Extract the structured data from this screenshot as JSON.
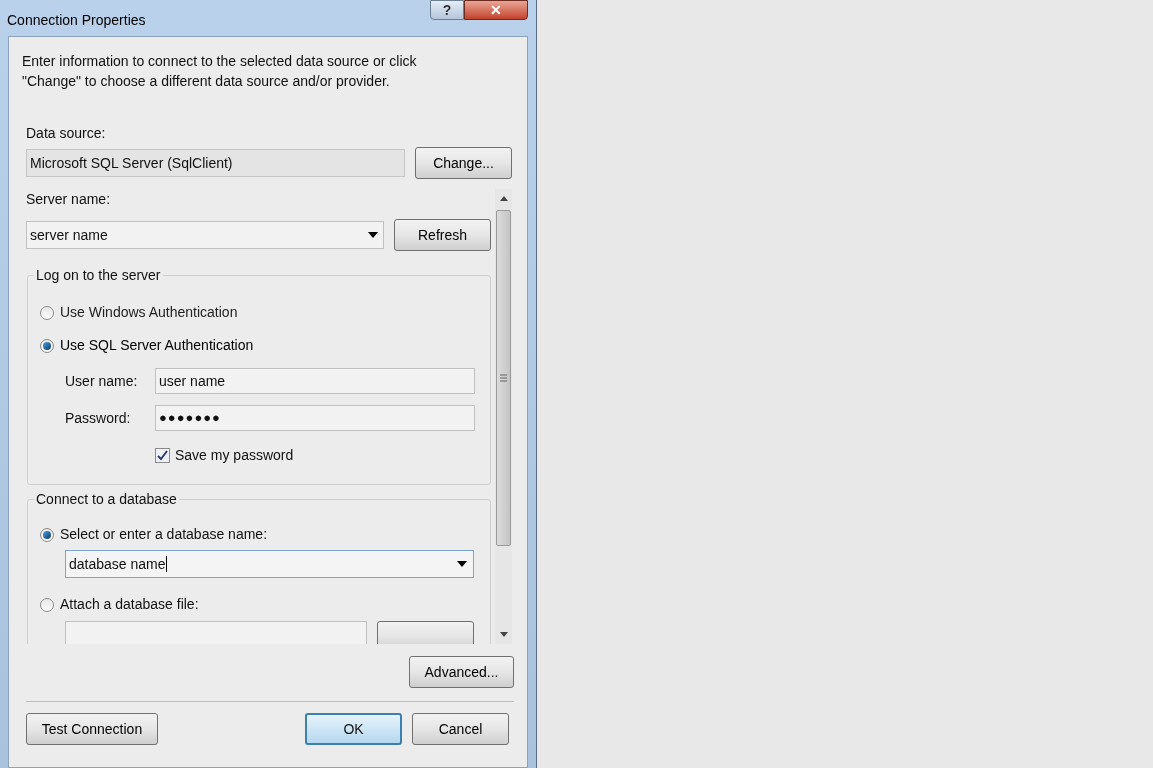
{
  "window": {
    "title": "Connection Properties",
    "help_button": "?",
    "close_button": "✕"
  },
  "instructions": "Enter information to connect to the selected data source or click \"Change\" to choose a different data source and/or provider.",
  "data_source": {
    "label": "Data source:",
    "value": "Microsoft SQL Server (SqlClient)",
    "button": "Change..."
  },
  "server": {
    "label": "Server name:",
    "value": "server name",
    "button": "Refresh"
  },
  "logon": {
    "title": "Log on to the server",
    "options": [
      {
        "label": "Use Windows Authentication",
        "selected": false
      },
      {
        "label": "Use SQL Server Authentication",
        "selected": true
      }
    ],
    "user_name": {
      "label": "User name:",
      "value": "user name"
    },
    "password": {
      "label": "Password:",
      "value": "●●●●●●●"
    },
    "save_password": {
      "label": "Save my password",
      "checked": true
    }
  },
  "database": {
    "title": "Connect to a database",
    "options": [
      {
        "label": "Select or enter a database name:",
        "selected": true
      },
      {
        "label": "Attach a database file:",
        "selected": false
      }
    ],
    "database_name": {
      "value": "database name"
    }
  },
  "advanced_button": "Advanced...",
  "buttons": [
    {
      "label": "Test Connection",
      "kind": "normal"
    },
    {
      "label": "OK",
      "kind": "default"
    },
    {
      "label": "Cancel",
      "kind": "normal"
    }
  ]
}
